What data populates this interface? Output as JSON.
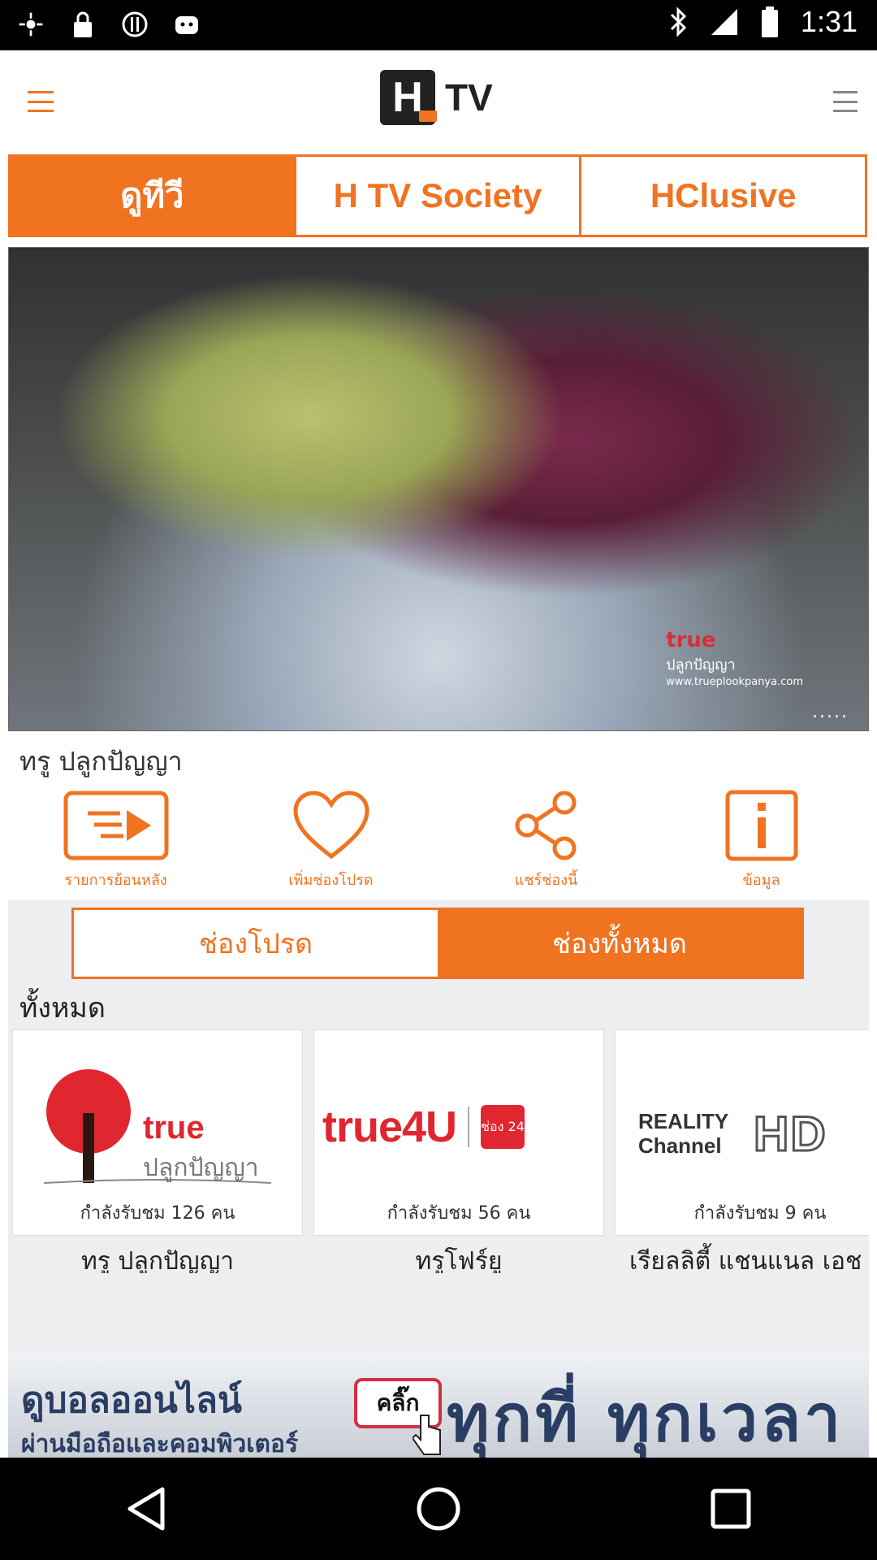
{
  "status_bar": {
    "time": "1:31",
    "icons": [
      "gps-icon",
      "lock-icon",
      "sync-icon",
      "android-icon",
      "bluetooth-icon",
      "signal-icon",
      "battery-icon"
    ]
  },
  "header": {
    "logo_letter": "H",
    "title": "TV",
    "brand_color": "#f07320"
  },
  "tabs": [
    {
      "label": "ดูทีวี",
      "active": true
    },
    {
      "label": "H TV Society",
      "active": false
    },
    {
      "label": "HClusive",
      "active": false
    }
  ],
  "player": {
    "watermark_brand": "true",
    "watermark_line": "ปลูกปัญญา",
    "watermark_url": "www.trueplookpanya.com",
    "more": "....."
  },
  "current_channel": {
    "title": "ทรู ปลูกปัญญา"
  },
  "actions": [
    {
      "label": "รายการย้อนหลัง",
      "icon": "playlist-play-icon"
    },
    {
      "label": "เพิ่มช่องโปรด",
      "icon": "heart-icon"
    },
    {
      "label": "แชร์ช่องนี้",
      "icon": "share-icon"
    },
    {
      "label": "ข้อมูล",
      "icon": "info-icon"
    }
  ],
  "segments": [
    {
      "label": "ช่องโปรด",
      "active": false
    },
    {
      "label": "ช่องทั้งหมด",
      "active": true
    }
  ],
  "list_heading": "ทั้งหมด",
  "channels": [
    {
      "logo_text": "true",
      "logo_sub": "ปลูกปัญญา",
      "viewers": "กำลังรับชม 126 คน",
      "name": "ทรู ปลูกปัญญา"
    },
    {
      "logo_text": "true4U",
      "logo_sub": "ช่อง 24",
      "viewers": "กำลังรับชม 56 คน",
      "name": "ทรูโฟร์ยู"
    },
    {
      "logo_text": "REALITY Channel",
      "logo_sub": "HD",
      "viewers": "กำลังรับชม 9 คน",
      "name": "เรียลลิตี้ แชนแนล เอช"
    }
  ],
  "banner": {
    "line1": "ดูบอลออนไลน์",
    "line2": "ผ่านมือถือและคอมพิวเตอร์",
    "button": "คลิ๊ก",
    "slogan": "ทุกที่ ทุกเวลา"
  },
  "nav_bar": {
    "buttons": [
      "back-icon",
      "home-icon",
      "recents-icon"
    ]
  }
}
